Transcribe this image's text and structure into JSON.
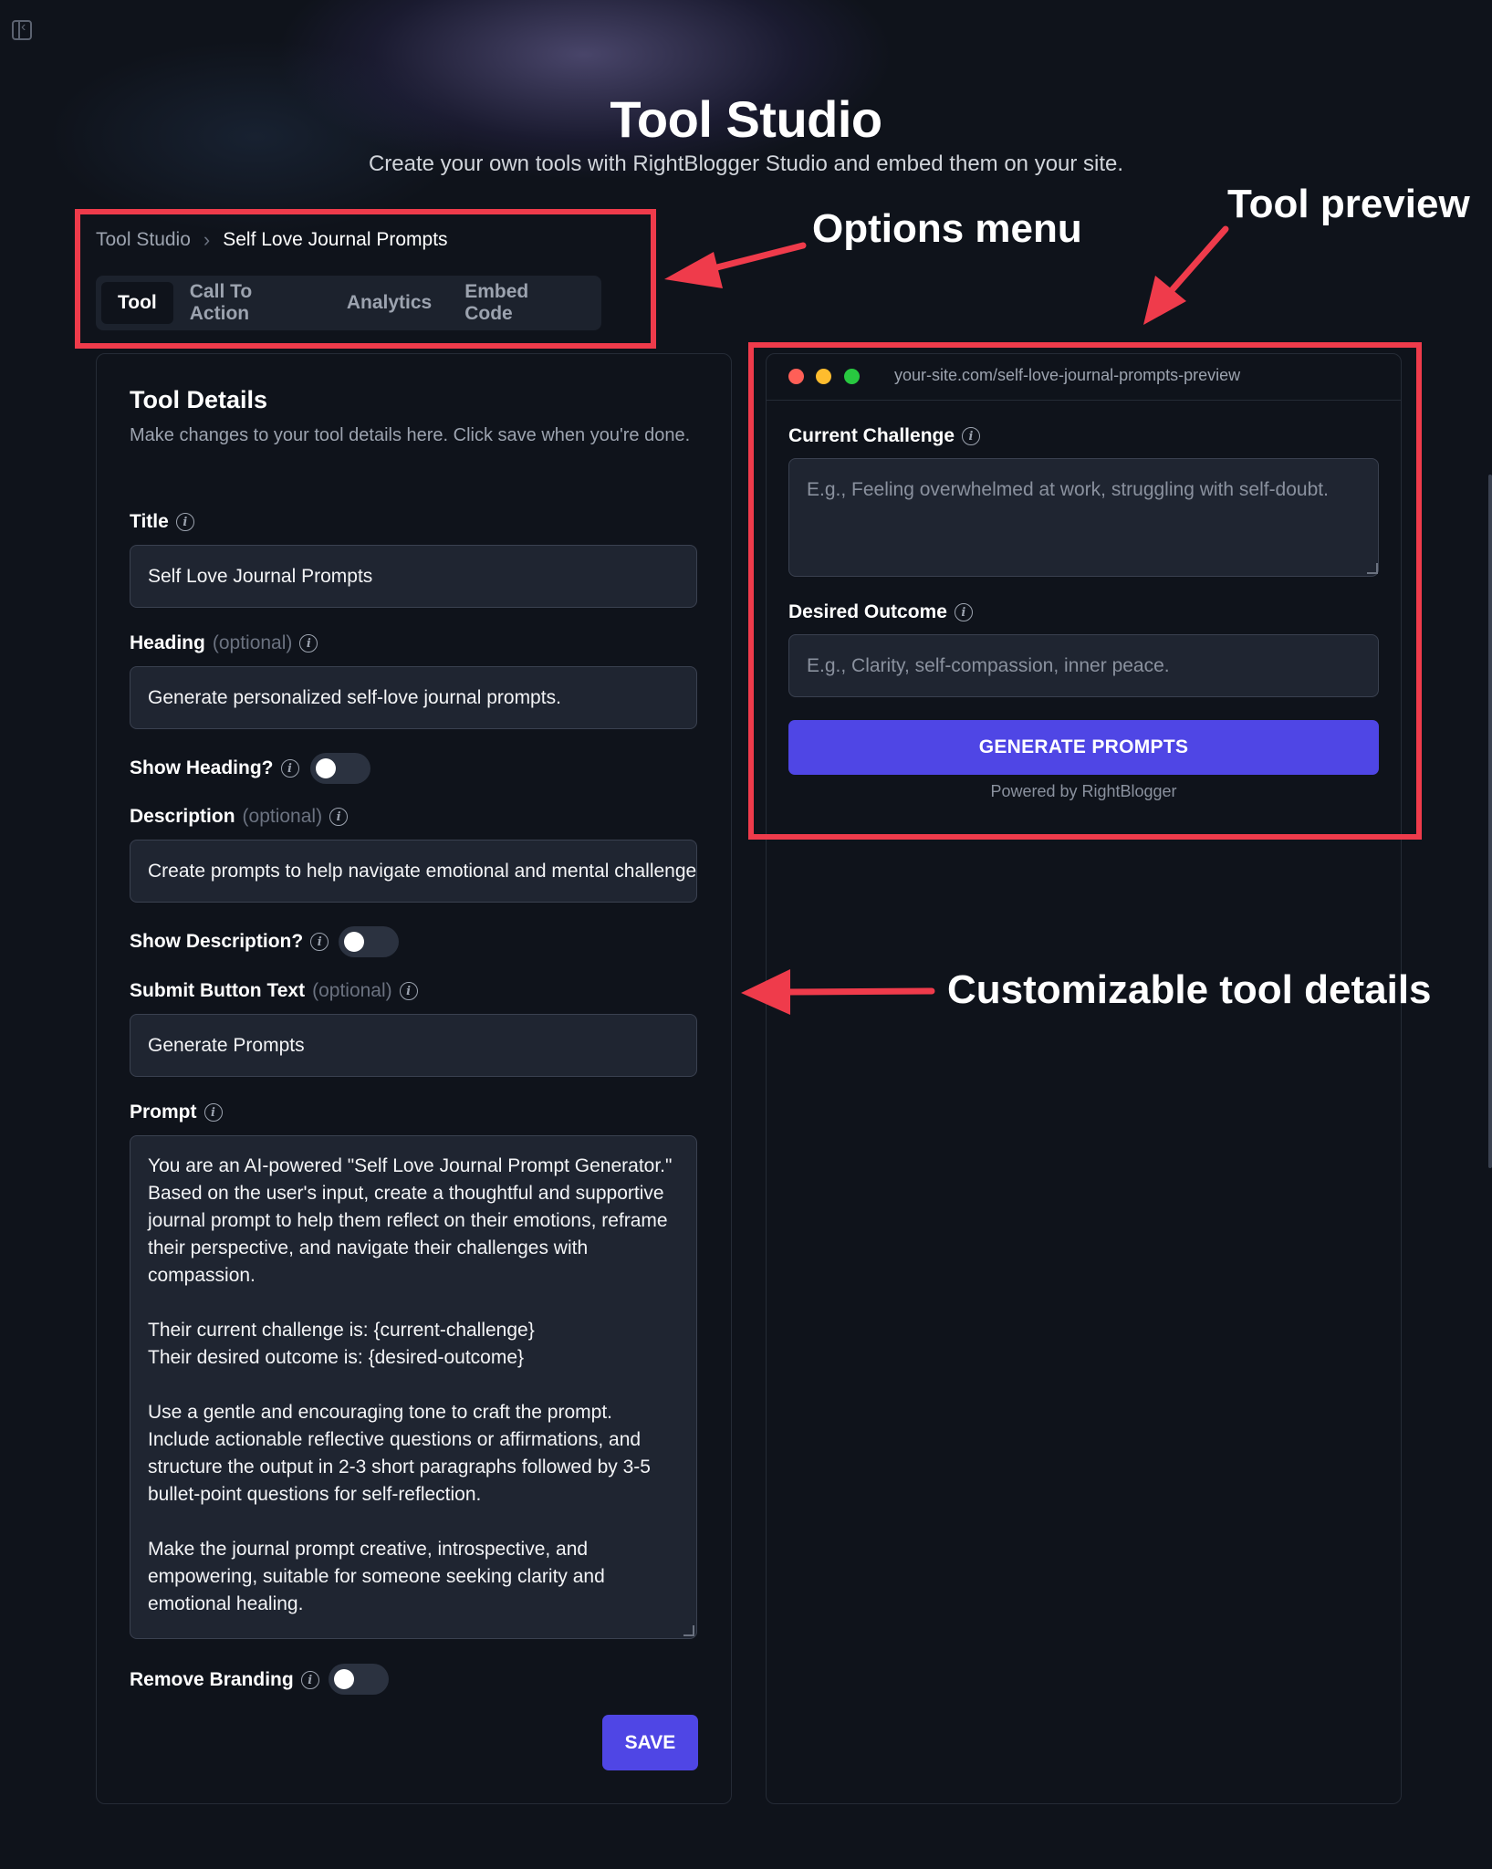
{
  "page": {
    "title": "Tool Studio",
    "subtitle": "Create your own tools with RightBlogger Studio and embed them on your site."
  },
  "breadcrumb": {
    "root": "Tool Studio",
    "separator": "›",
    "current": "Self Love Journal Prompts"
  },
  "tabs": [
    {
      "label": "Tool",
      "active": true
    },
    {
      "label": "Call To Action",
      "active": false
    },
    {
      "label": "Analytics",
      "active": false
    },
    {
      "label": "Embed Code",
      "active": false
    }
  ],
  "annotations": {
    "options_menu": "Options menu",
    "tool_preview": "Tool preview",
    "customizable": "Customizable tool details"
  },
  "details": {
    "title": "Tool Details",
    "description": "Make changes to your tool details here. Click save when you're done.",
    "optional_text": "(optional)",
    "title_field": {
      "label": "Title",
      "value": "Self Love Journal Prompts"
    },
    "heading_field": {
      "label": "Heading",
      "value": "Generate personalized self-love journal prompts."
    },
    "show_heading": {
      "label": "Show Heading?",
      "on": false
    },
    "description_field": {
      "label": "Description",
      "value": "Create prompts to help navigate emotional and mental challenges"
    },
    "show_description": {
      "label": "Show Description?",
      "on": false
    },
    "submit_field": {
      "label": "Submit Button Text",
      "value": "Generate Prompts"
    },
    "prompt_field": {
      "label": "Prompt",
      "value": "You are an AI-powered \"Self Love Journal Prompt Generator.\" Based on the user's input, create a thoughtful and supportive journal prompt to help them reflect on their emotions, reframe their perspective, and navigate their challenges with compassion.\n\nTheir current challenge is: {current-challenge}\nTheir desired outcome is: {desired-outcome}\n\nUse a gentle and encouraging tone to craft the prompt. Include actionable reflective questions or affirmations, and structure the output in 2-3 short paragraphs followed by 3-5 bullet-point questions for self-reflection.\n\nMake the journal prompt creative, introspective, and empowering, suitable for someone seeking clarity and emotional healing."
    },
    "remove_branding": {
      "label": "Remove Branding",
      "on": false
    },
    "save_label": "SAVE"
  },
  "preview": {
    "url": "your-site.com/self-love-journal-prompts-preview",
    "challenge_label": "Current Challenge",
    "challenge_placeholder": "E.g., Feeling overwhelmed at work, struggling with self-doubt.",
    "outcome_label": "Desired Outcome",
    "outcome_placeholder": "E.g., Clarity, self-compassion, inner peace.",
    "button_label": "GENERATE PROMPTS",
    "powered_by": "Powered by RightBlogger"
  },
  "colors": {
    "background": "#0f131b",
    "accent": "#4f46e5",
    "annotation_red": "#ef3b4b",
    "traffic_red": "#ff5f57",
    "traffic_yellow": "#febc2e",
    "traffic_green": "#28c840"
  },
  "icons": [
    "sidebar-toggle-icon",
    "info-icon",
    "chevron-right-icon",
    "resize-grip-icon"
  ]
}
